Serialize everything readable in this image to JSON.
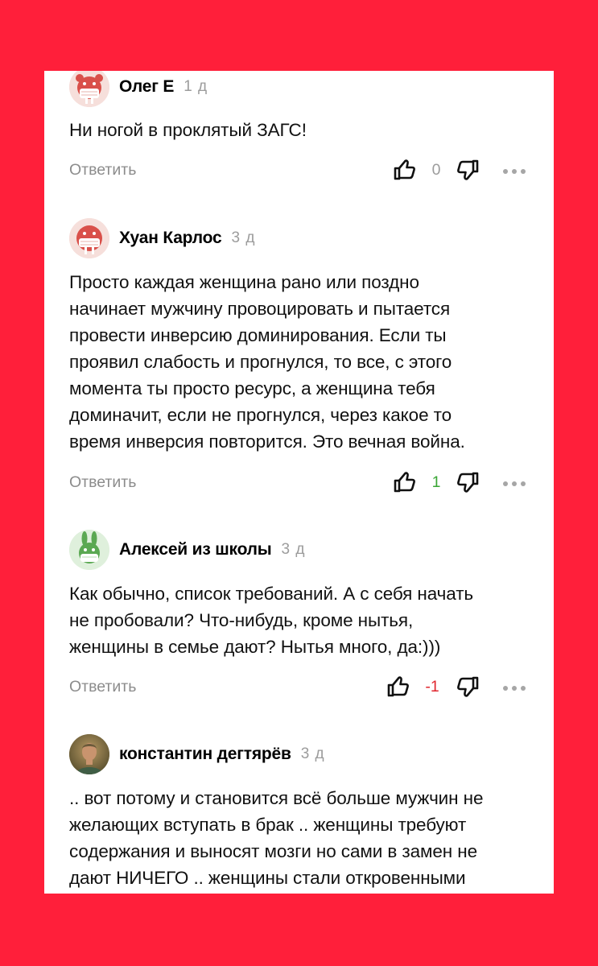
{
  "comments": [
    {
      "author": "Олег Е",
      "age": "1 д",
      "avatar_icon": "walrus-mask-icon",
      "avatar_color": "#f4dcd8",
      "text_lines": [
        "Ни ногой в проклятый ЗАГС!"
      ],
      "reply_label": "Ответить",
      "rating": "0",
      "rating_color": "#9c9c9c"
    },
    {
      "author": "Хуан Карлос",
      "age": "3 д",
      "avatar_icon": "walrus-mask-icon",
      "avatar_color": "#f4dcd8",
      "text_lines": [
        "Просто каждая женщина рано или поздно",
        "начинает мужчину провоцировать и пытается",
        "провести инверсию доминирования. Если ты",
        "проявил слабость и прогнулся, то все, с этого",
        "момента ты просто ресурс, а женщина тебя",
        "доминачит, если не прогнулся, через какое то",
        "время инверсия повторится. Это вечная война."
      ],
      "reply_label": "Ответить",
      "rating": "1",
      "rating_color": "#3aa635"
    },
    {
      "author": "Алексей из школы",
      "age": "3 д",
      "avatar_icon": "rabbit-mask-icon",
      "avatar_color": "#dff0dc",
      "text_lines": [
        "Как обычно, список требований. А с себя начать",
        "не пробовали? Что-нибудь, кроме нытья,",
        "женщины в семье дают? Нытья много, да:)))"
      ],
      "reply_label": "Ответить",
      "rating": "-1",
      "rating_color": "#e0262e"
    },
    {
      "author": "константин дегтярёв",
      "age": "3 д",
      "avatar_icon": "user-photo-icon",
      "avatar_color": "#7a6a3c",
      "text_lines": [
        ".. вот потому и становится всё больше мужчин не",
        "желающих вступать в брак .. женщины требуют",
        "содержания и выносят мозги но сами в замен не",
        "дают НИЧЕГО .. женщины стали откровенными"
      ]
    }
  ]
}
